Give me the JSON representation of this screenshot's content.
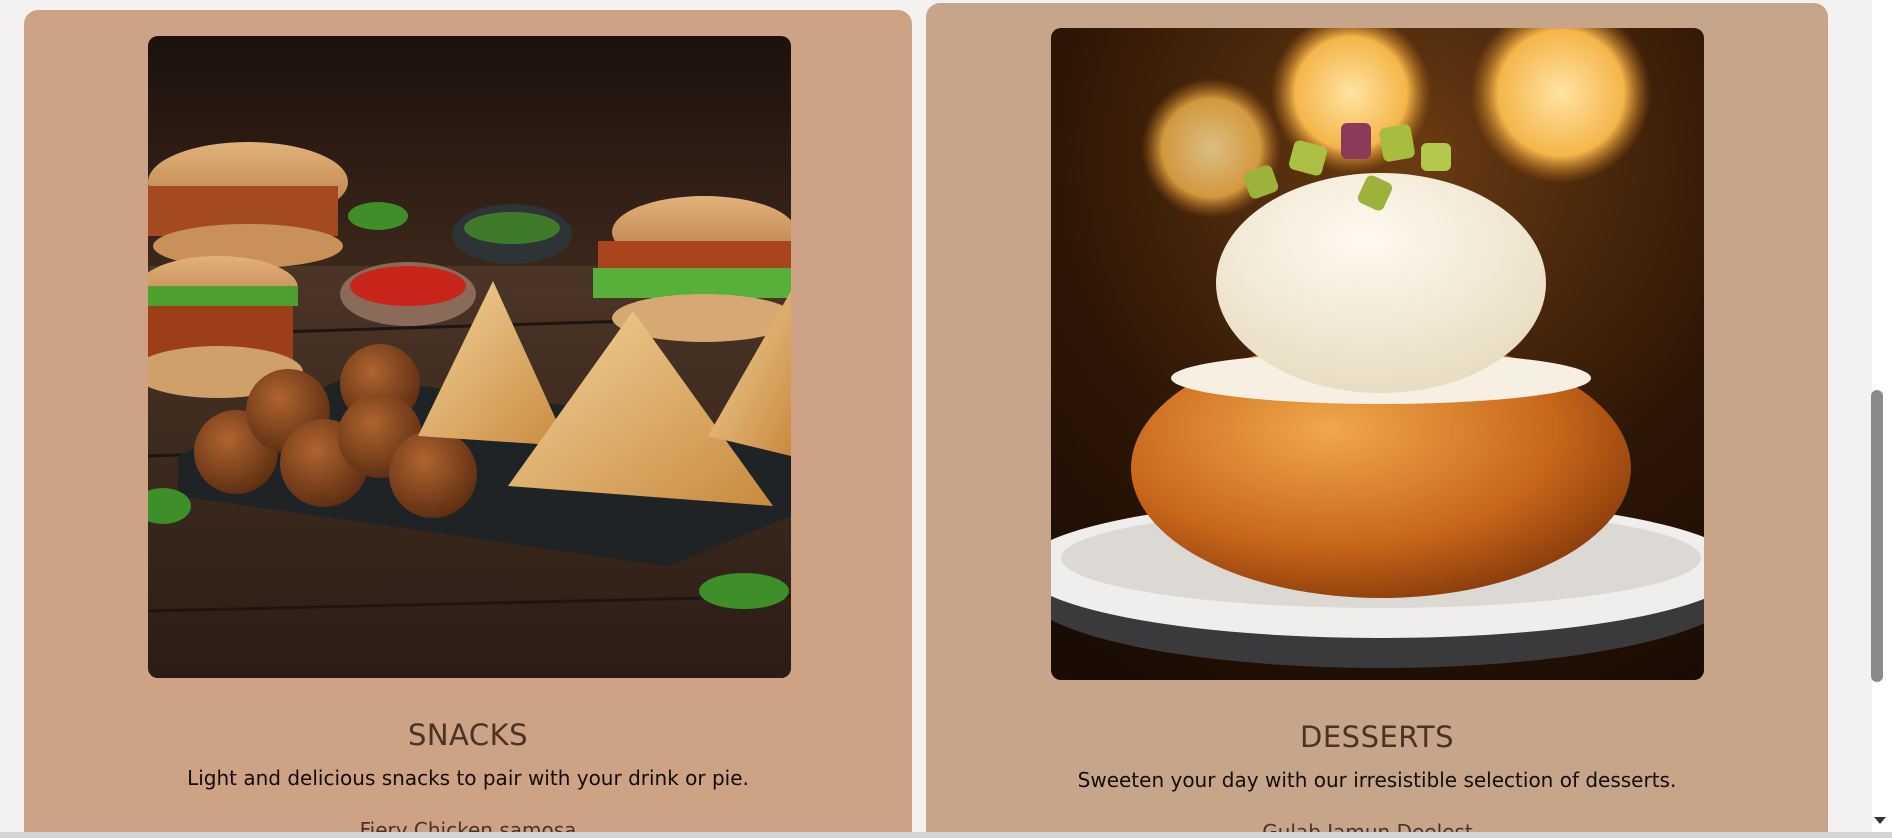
{
  "cards": [
    {
      "title": "SNACKS",
      "description": "Light and delicious snacks to pair with your drink or pie.",
      "first_item": "Fiery Chicken samosa",
      "image_icon": "snacks-photo"
    },
    {
      "title": "DESSERTS",
      "description": "Sweeten your day with our irresistible selection of desserts.",
      "first_item": "Gulab Jamun Deelest...",
      "image_icon": "dessert-photo"
    }
  ],
  "colors": {
    "snacks_card": "#cea284",
    "desserts_card": "#c7a58b",
    "title_text": "#4a3226",
    "page_bg": "#f4f2f0"
  }
}
